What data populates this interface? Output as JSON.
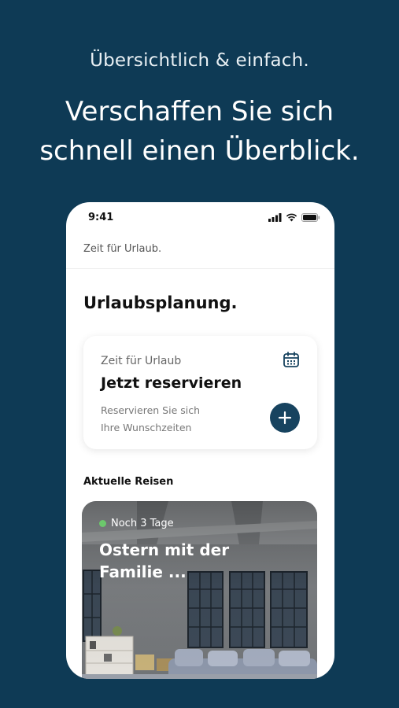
{
  "promo": {
    "tagline": "Übersichtlich & einfach.",
    "headline_line1": "Verschaffen Sie sich",
    "headline_line2": "schnell einen Überblick."
  },
  "status_bar": {
    "time": "9:41",
    "icons": [
      "signal-icon",
      "wifi-icon",
      "battery-icon"
    ]
  },
  "app": {
    "header_title": "Zeit für Urlaub.",
    "page_title": "Urlaubsplanung."
  },
  "reservation_card": {
    "subtitle": "Zeit für Urlaub",
    "title": "Jetzt reservieren",
    "description_line1": "Reservieren Sie sich",
    "description_line2": "Ihre Wunschzeiten",
    "icon": "calendar-icon",
    "action_icon": "plus-icon"
  },
  "trips": {
    "section_title": "Aktuelle Reisen",
    "items": [
      {
        "badge": "Noch 3 Tage",
        "title_line1": "Ostern mit der",
        "title_line2": "Familie ..."
      }
    ]
  },
  "colors": {
    "background": "#0e3a55",
    "accent": "#17435f",
    "status_dot": "#6cc86c"
  }
}
